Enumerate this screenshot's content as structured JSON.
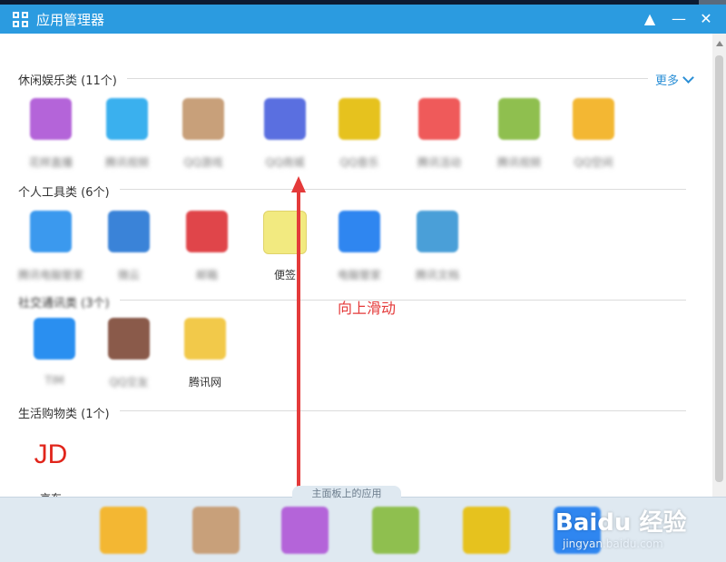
{
  "window": {
    "title": "应用管理器"
  },
  "sections": [
    {
      "title": "休闲娱乐类 (11个)",
      "more_label": "更多"
    },
    {
      "title": "个人工具类 (6个)"
    },
    {
      "title": "社交通讯类 (3个)"
    },
    {
      "title": "生活购物类 (1个)"
    }
  ],
  "apps": {
    "leisure": [
      {
        "name": "花样直播",
        "icon": "flower-app-icon",
        "color": "#b464d9"
      },
      {
        "name": "腾讯视频",
        "icon": "video-app-icon",
        "color": "#3ab0ee"
      },
      {
        "name": "QQ游戏",
        "icon": "game-app-icon",
        "color": "#c8a07a"
      },
      {
        "name": "QQ商城",
        "icon": "mall-app-icon",
        "color": "#5a6fe0"
      },
      {
        "name": "QQ音乐",
        "icon": "music-app-icon",
        "color": "#e6c21e"
      },
      {
        "name": "腾讯活动",
        "icon": "event-app-icon",
        "color": "#ef5a5a"
      },
      {
        "name": "腾讯视频",
        "icon": "tv-app-icon",
        "color": "#8fbf4f"
      },
      {
        "name": "QQ空间",
        "icon": "space-app-icon",
        "color": "#f3b733"
      }
    ],
    "tools": [
      {
        "name": "腾讯电脑管家",
        "icon": "manager-app-icon",
        "color": "#3b99ee"
      },
      {
        "name": "微云",
        "icon": "cloud-app-icon",
        "color": "#3a83d8"
      },
      {
        "name": "邮箱",
        "icon": "mail-app-icon",
        "color": "#e0454a"
      },
      {
        "name": "便签",
        "icon": "notes-app-icon",
        "color": "#f2ea80"
      },
      {
        "name": "电脑管家",
        "icon": "shield-app-icon",
        "color": "#2f86f0"
      },
      {
        "name": "腾讯文档",
        "icon": "docs-app-icon",
        "color": "#4a9fd8"
      }
    ],
    "social": [
      {
        "name": "TIM",
        "icon": "tim-app-icon",
        "color": "#2a8ff0"
      },
      {
        "name": "QQ交友",
        "icon": "friends-app-icon",
        "color": "#8a5a4a"
      },
      {
        "name": "腾讯网",
        "icon": "news-app-icon",
        "color": "#f2c94a"
      }
    ],
    "shopping": [
      {
        "name": "京东",
        "logo": "JD",
        "icon": "jd-app-icon",
        "color": "#e1251b"
      }
    ]
  },
  "annotation": {
    "text": "向上滑动"
  },
  "dock": {
    "label": "主面板上的应用",
    "items": [
      {
        "icon": "dock-app-1-icon",
        "color": "#f3b733"
      },
      {
        "icon": "dock-app-2-icon",
        "color": "#c8a07a"
      },
      {
        "icon": "dock-app-3-icon",
        "color": "#b464d9"
      },
      {
        "icon": "dock-app-4-icon",
        "color": "#8fbf4f"
      },
      {
        "icon": "dock-app-5-icon",
        "color": "#e6c21e"
      },
      {
        "icon": "dock-app-6-icon",
        "color": "#2f86f0"
      }
    ]
  },
  "watermark": {
    "main": "Baidu 经验",
    "sub": "jingyan.baidu.com"
  }
}
